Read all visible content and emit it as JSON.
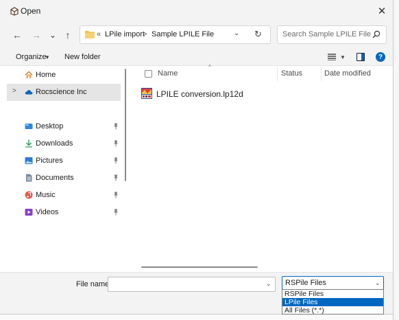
{
  "window": {
    "title": "Open",
    "close_glyph": "✕"
  },
  "nav": {
    "back_glyph": "←",
    "forward_glyph": "→",
    "recent_glyph": "⌄",
    "up_glyph": "↑",
    "address": {
      "overflow": "«",
      "crumbs": [
        "LPile import",
        "Sample LPILE File"
      ],
      "separator": ">",
      "dropdown_glyph": "⌄",
      "refresh_glyph": "↻"
    },
    "search": {
      "placeholder": "Search Sample LPILE File",
      "icon": "search-icon"
    }
  },
  "toolbar": {
    "organize_label": "Organize",
    "organize_caret": "▼",
    "new_folder_label": "New folder",
    "view_caret": "▼",
    "help_glyph": "?"
  },
  "sidebar": {
    "items": [
      {
        "label": "Home",
        "icon": "home-icon",
        "pinned": false
      },
      {
        "label": "Rocscience Inc",
        "icon": "cloud-icon",
        "pinned": false,
        "selected": true,
        "expander": ">"
      },
      {
        "label": "Desktop",
        "icon": "desktop-icon",
        "pinned": true
      },
      {
        "label": "Downloads",
        "icon": "download-icon",
        "pinned": true
      },
      {
        "label": "Pictures",
        "icon": "pictures-icon",
        "pinned": true
      },
      {
        "label": "Documents",
        "icon": "documents-icon",
        "pinned": true
      },
      {
        "label": "Music",
        "icon": "music-icon",
        "pinned": true
      },
      {
        "label": "Videos",
        "icon": "videos-icon",
        "pinned": true
      }
    ]
  },
  "filelist": {
    "columns": [
      "Name",
      "Status",
      "Date modified"
    ],
    "sort_indicator": "^",
    "files": [
      {
        "name": "LPILE conversion.lp12d",
        "icon": "lpile-file-icon"
      }
    ]
  },
  "footer": {
    "file_name_label": "File name:",
    "file_name_value": "",
    "file_name_dropdown_glyph": "⌄",
    "file_type_selected": "RSPile Files",
    "file_type_chevron": "⌄",
    "file_type_options": [
      "RSPile Files",
      "LPile Files",
      "All Files (*.*)"
    ],
    "file_type_highlighted": "LPile Files"
  },
  "colors": {
    "accent": "#0067c0",
    "chrome": "#f3f3f3",
    "selection": "#e5e5e5"
  }
}
